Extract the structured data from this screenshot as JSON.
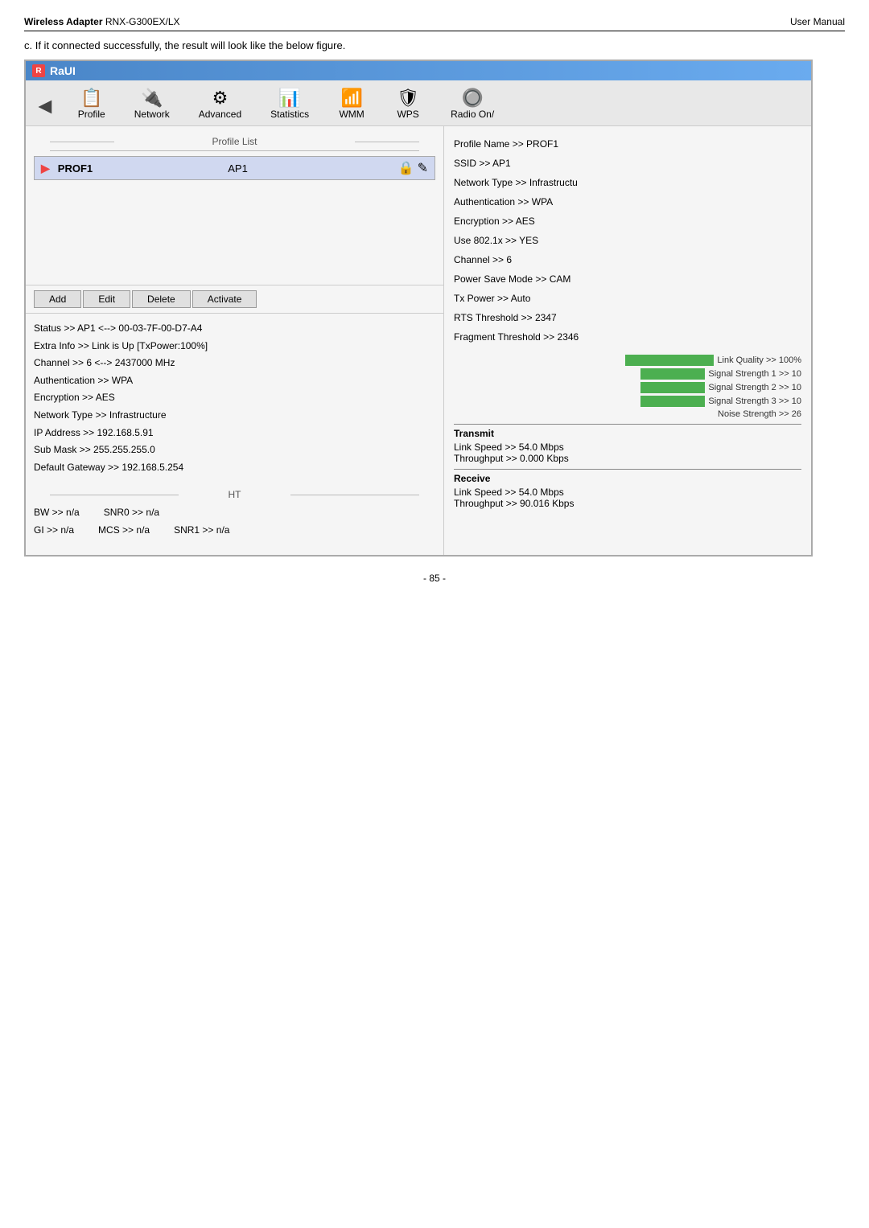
{
  "page": {
    "header_left_plain": "Wireless Adapter",
    "header_left_model": " RNX-G300EX/LX",
    "header_right": "User Manual",
    "description": "c. If it connected successfully, the result will look like the below figure.",
    "page_number": "- 85 -"
  },
  "raui": {
    "title": "RaUI",
    "toolbar": {
      "back_icon": "◄",
      "items": [
        {
          "id": "profile",
          "label": "Profile",
          "icon": "📋"
        },
        {
          "id": "network",
          "label": "Network",
          "icon": "🔌"
        },
        {
          "id": "advanced",
          "label": "Advanced",
          "icon": "⚙"
        },
        {
          "id": "statistics",
          "label": "Statistics",
          "icon": "📊"
        },
        {
          "id": "wmm",
          "label": "WMM",
          "icon": "📶"
        },
        {
          "id": "wps",
          "label": "WPS",
          "icon": "🛡"
        },
        {
          "id": "radio",
          "label": "Radio On/",
          "icon": "🔘"
        }
      ]
    },
    "profile_list": {
      "header": "Profile List",
      "profiles": [
        {
          "name": "PROF1",
          "ssid": "AP1"
        }
      ]
    },
    "profile_details": {
      "name": "Profile Name >> PROF1",
      "ssid": "SSID >> AP1",
      "network_type": "Network Type >> Infrastructu",
      "authentication": "Authentication >> WPA",
      "encryption": "Encryption >> AES",
      "use_8021x": "Use 802.1x >> YES",
      "channel": "Channel >> 6",
      "power_save": "Power Save Mode >> CAM",
      "tx_power": "Tx Power >> Auto",
      "rts_threshold": "RTS Threshold >> 2347",
      "fragment_threshold": "Fragment Threshold >> 2346"
    },
    "action_buttons": {
      "add": "Add",
      "edit": "Edit",
      "delete": "Delete",
      "activate": "Activate"
    },
    "status": {
      "status": "Status >> AP1 <--> 00-03-7F-00-D7-A4",
      "extra_info": "Extra Info >> Link is Up [TxPower:100%]",
      "channel": "Channel >> 6 <--> 2437000 MHz",
      "authentication": "Authentication >> WPA",
      "encryption": "Encryption >> AES",
      "network_type": "Network Type >> Infrastructure",
      "ip_address": "IP Address >> 192.168.5.91",
      "sub_mask": "Sub Mask >> 255.255.255.0",
      "default_gateway": "Default Gateway >> 192.168.5.254"
    },
    "ht": {
      "header": "HT",
      "bw": "BW >> n/a",
      "gi": "GI >> n/a",
      "mcs": "MCS >> n/a",
      "snr0": "SNR0 >> n/a",
      "snr1": "SNR1 >> n/a"
    },
    "signal": {
      "link_quality": "Link Quality >> 100%",
      "signal_strength_1": "Signal Strength 1 >> 10",
      "signal_strength_2": "Signal Strength 2 >> 10",
      "signal_strength_3": "Signal Strength 3 >> 10",
      "noise_strength": "Noise Strength >> 26"
    },
    "transmit": {
      "label": "Transmit",
      "link_speed": "Link Speed >> 54.0 Mbps",
      "throughput": "Throughput >> 0.000 Kbps"
    },
    "receive": {
      "label": "Receive",
      "link_speed": "Link Speed >> 54.0 Mbps",
      "throughput": "Throughput >> 90.016 Kbps"
    }
  }
}
